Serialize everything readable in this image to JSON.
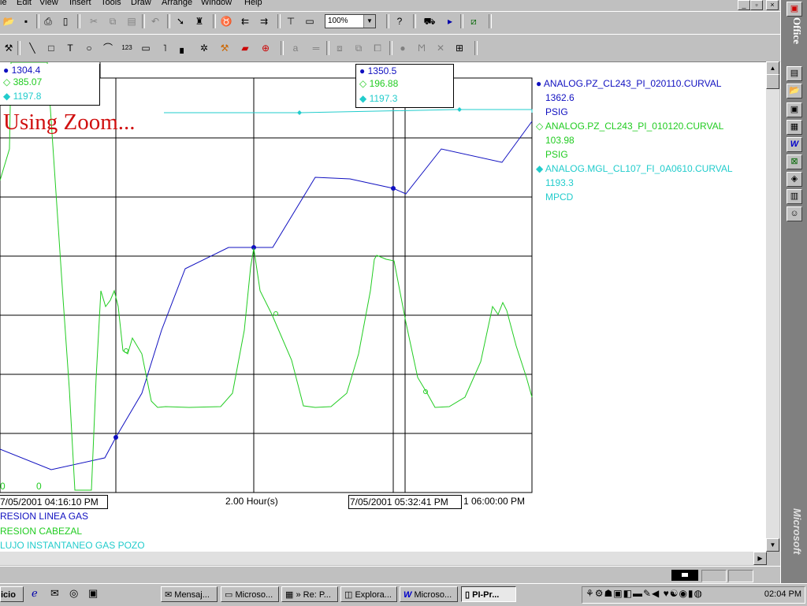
{
  "menu": [
    "le",
    "Edit",
    "View",
    "Insert",
    "Tools",
    "Draw",
    "Arrange",
    "Window",
    "Help"
  ],
  "window_buttons": [
    "_",
    "▫",
    "×"
  ],
  "toolbar1": {
    "zoom": "100%",
    "icons": [
      "open-icon",
      "save-icon",
      "print-icon",
      "print-preview-icon",
      "cut-icon",
      "copy-icon",
      "paste-icon",
      "undo-icon",
      "pointer-icon",
      "find-icon",
      "tag-icon",
      "align-left-icon",
      "align-right-icon",
      "trend-icon",
      "window-icon",
      "help-icon",
      "run-icon",
      "play-icon",
      "chart-icon"
    ]
  },
  "toolbar2": {
    "icons": [
      "wrench-icon",
      "line-icon",
      "rectangle-icon",
      "text-icon",
      "ellipse-icon",
      "arc-icon",
      "value-icon",
      "rounded-rect-icon",
      "polyline-icon",
      "bar-icon",
      "symbol-icon",
      "tools-icon",
      "trend-tool-icon",
      "target-icon",
      "font-icon",
      "lines-icon",
      "group-icon",
      "ungroup-icon",
      "layer-icon",
      "fill-icon",
      "pen-icon",
      "delete-icon",
      "properties-icon"
    ]
  },
  "cursor_left": {
    "v1": "1304.4",
    "v2": "385.07",
    "v3": "1197.8",
    "time": "7/05/2001 04:16:10 PM"
  },
  "cursor_right": {
    "v1": "1350.5",
    "v2": "196.88",
    "v3": "1197.3",
    "time": "7/05/2001 05:32:41 PM"
  },
  "overlay_text": "Using Zoom...",
  "axis": {
    "span": "2.00 Hour(s)",
    "end_time": "1 06:00:00 PM",
    "min_labels": [
      "0",
      "0"
    ]
  },
  "legend_right": [
    {
      "tag": "ANALOG.PZ_CL243_PI_020110.CURVAL",
      "value": "1362.6",
      "unit": "PSIG",
      "color": "#1010c0"
    },
    {
      "tag": "ANALOG.PZ_CL243_PI_010120.CURVAL",
      "value": "103.98",
      "unit": "PSIG",
      "color": "#22cc22"
    },
    {
      "tag": "ANALOG.MGL_CL107_FI_0A0610.CURVAL",
      "value": "1193.3",
      "unit": "MPCD",
      "color": "#22cccc"
    }
  ],
  "trend_names": [
    "RESION LINEA GAS",
    "RESION CABEZAL",
    "LUJO INSTANTANEO GAS POZO"
  ],
  "officebar_label": "Office",
  "officebar_brand": "Microsoft",
  "taskbar": {
    "start": "icio",
    "tasks": [
      "Mensaj...",
      "Microso...",
      "» Re: P...",
      "Explora...",
      "Microso...",
      "PI-Pr..."
    ],
    "clock": "02:04 PM"
  }
}
